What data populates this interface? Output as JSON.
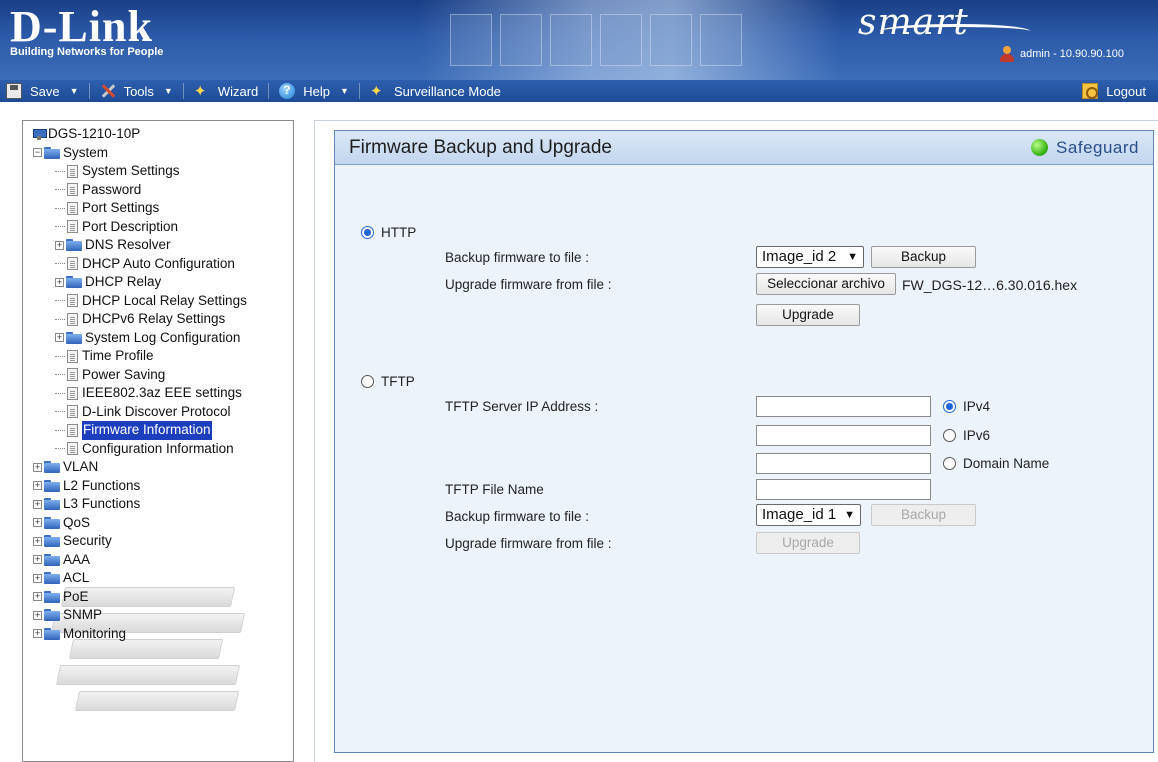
{
  "header": {
    "brand": "D-Link",
    "tagline": "Building Networks for People",
    "product_word": "smart",
    "admin_info": "admin - 10.90.90.100"
  },
  "menubar": {
    "save": "Save",
    "tools": "Tools",
    "wizard": "Wizard",
    "help": "Help",
    "surveillance": "Surveillance Mode",
    "logout": "Logout"
  },
  "tree": {
    "root": "DGS-1210-10P",
    "system": "System",
    "system_children": [
      "System Settings",
      "Password",
      "Port Settings",
      "Port Description",
      "DNS Resolver",
      "DHCP Auto Configuration",
      "DHCP Relay",
      "DHCP Local Relay Settings",
      "DHCPv6 Relay Settings",
      "System Log Configuration",
      "Time Profile",
      "Power Saving",
      "IEEE802.3az EEE settings",
      "D-Link Discover Protocol",
      "Firmware Information",
      "Configuration Information"
    ],
    "top_folders": [
      "VLAN",
      "L2 Functions",
      "L3 Functions",
      "QoS",
      "Security",
      "AAA",
      "ACL",
      "PoE",
      "SNMP",
      "Monitoring"
    ]
  },
  "panel": {
    "title": "Firmware Backup and Upgrade",
    "safeguard": "Safeguard",
    "http": {
      "label": "HTTP",
      "selected": true,
      "backup_label": "Backup firmware to file :",
      "backup_select": "Image_id 2",
      "backup_button": "Backup",
      "upgrade_label": "Upgrade firmware from file :",
      "choose_file_button": "Seleccionar archivo",
      "chosen_file": "FW_DGS-12…6.30.016.hex",
      "upgrade_button": "Upgrade"
    },
    "tftp": {
      "label": "TFTP",
      "selected": false,
      "server_ip_label": "TFTP Server IP Address :",
      "ipv4_label": "IPv4",
      "ipv6_label": "IPv6",
      "domain_label": "Domain Name",
      "ipv4_value": "",
      "ipv6_value": "",
      "domain_value": "",
      "file_name_label": "TFTP File Name",
      "file_name_value": "",
      "backup_label": "Backup firmware to file :",
      "backup_select": "Image_id 1",
      "backup_button": "Backup",
      "upgrade_label": "Upgrade firmware from file :",
      "upgrade_button": "Upgrade"
    }
  },
  "colors": {
    "banner": "#2c5aa8",
    "menubar": "#1e4b96",
    "panel_bg": "#edf3fa",
    "panel_border": "#5f86b8",
    "selected_tree": "#1d3fbd",
    "safeguard_led": "#3fb81b"
  }
}
